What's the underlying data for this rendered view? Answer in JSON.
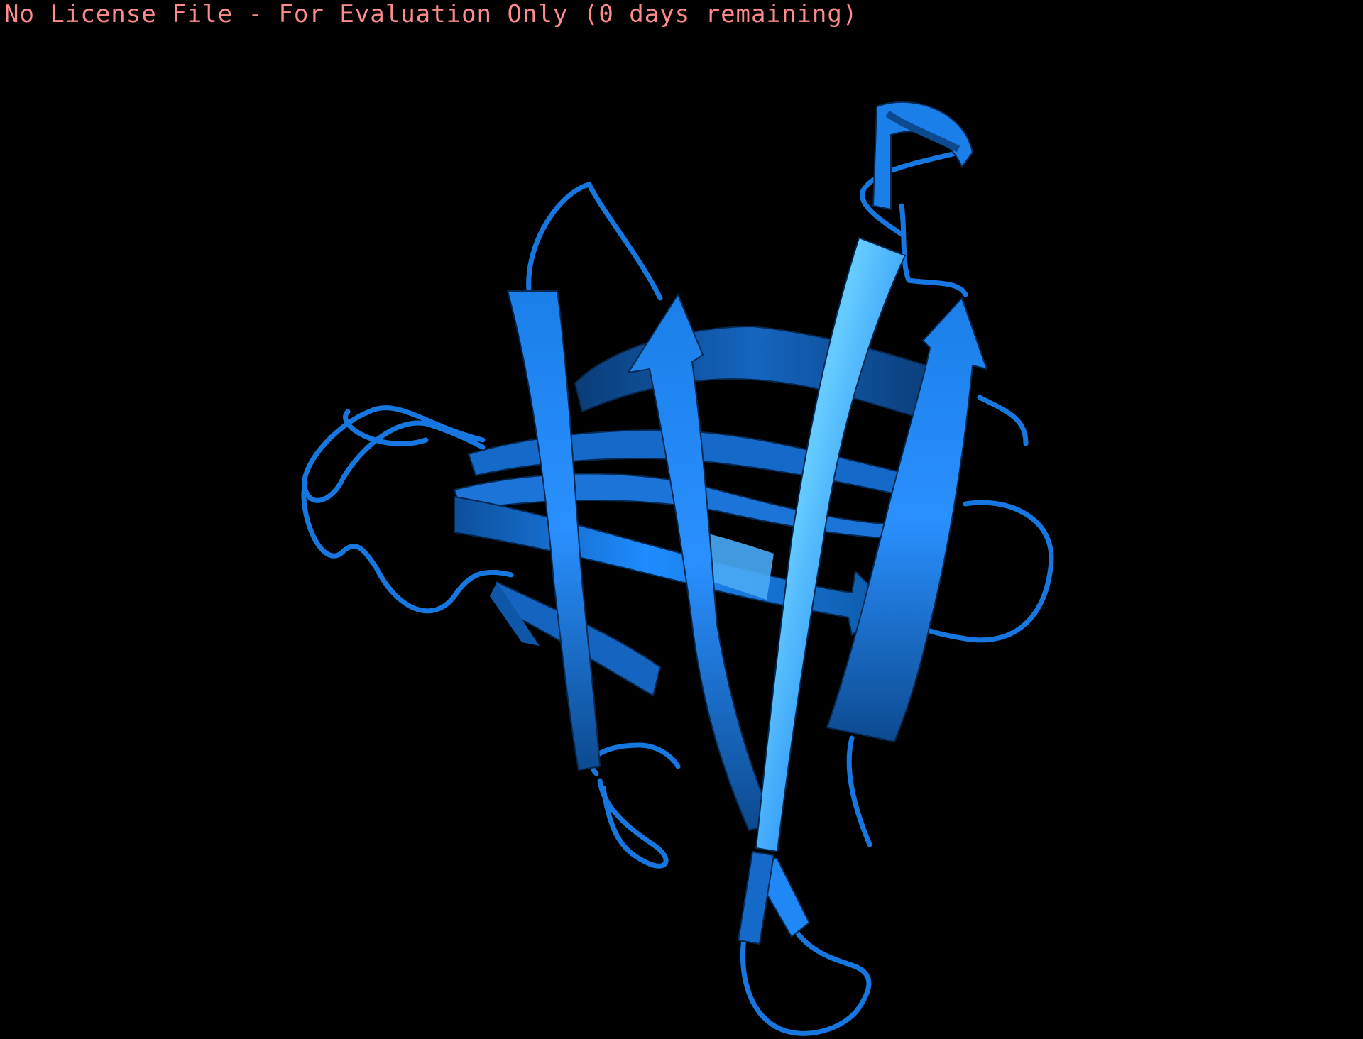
{
  "viewer": {
    "license_notice": "No License File - For Evaluation Only (0 days remaining)",
    "background_color": "#000000",
    "notice_color": "#ff8c8c"
  },
  "structure": {
    "representation": "cartoon",
    "ribbon_color": "#1a80f0",
    "highlight_color": "#66ccff",
    "shadow_color": "#0a3f7a"
  }
}
